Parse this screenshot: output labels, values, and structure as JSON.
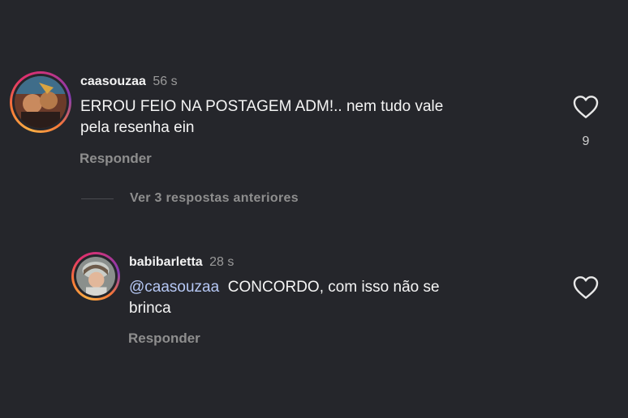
{
  "comments": [
    {
      "username": "caasouzaa",
      "time": "56 s",
      "text_line1": "ERROU FEIO NA POSTAGEM ADM!.. nem tudo vale",
      "text_line2": "pela resenha ein",
      "reply_label": "Responder",
      "like_count": "9"
    }
  ],
  "view_replies": "Ver 3 respostas anteriores",
  "replies": [
    {
      "username": "babibarletta",
      "time": "28 s",
      "mention": "@caasouzaa",
      "text_line1": "CONCORDO, com isso não se",
      "text_line2": "brinca",
      "reply_label": "Responder"
    }
  ],
  "colors": {
    "background": "#25262b",
    "mention": "#b6c8f5",
    "muted": "#8e8e8e"
  },
  "icons": [
    "heart-icon"
  ]
}
